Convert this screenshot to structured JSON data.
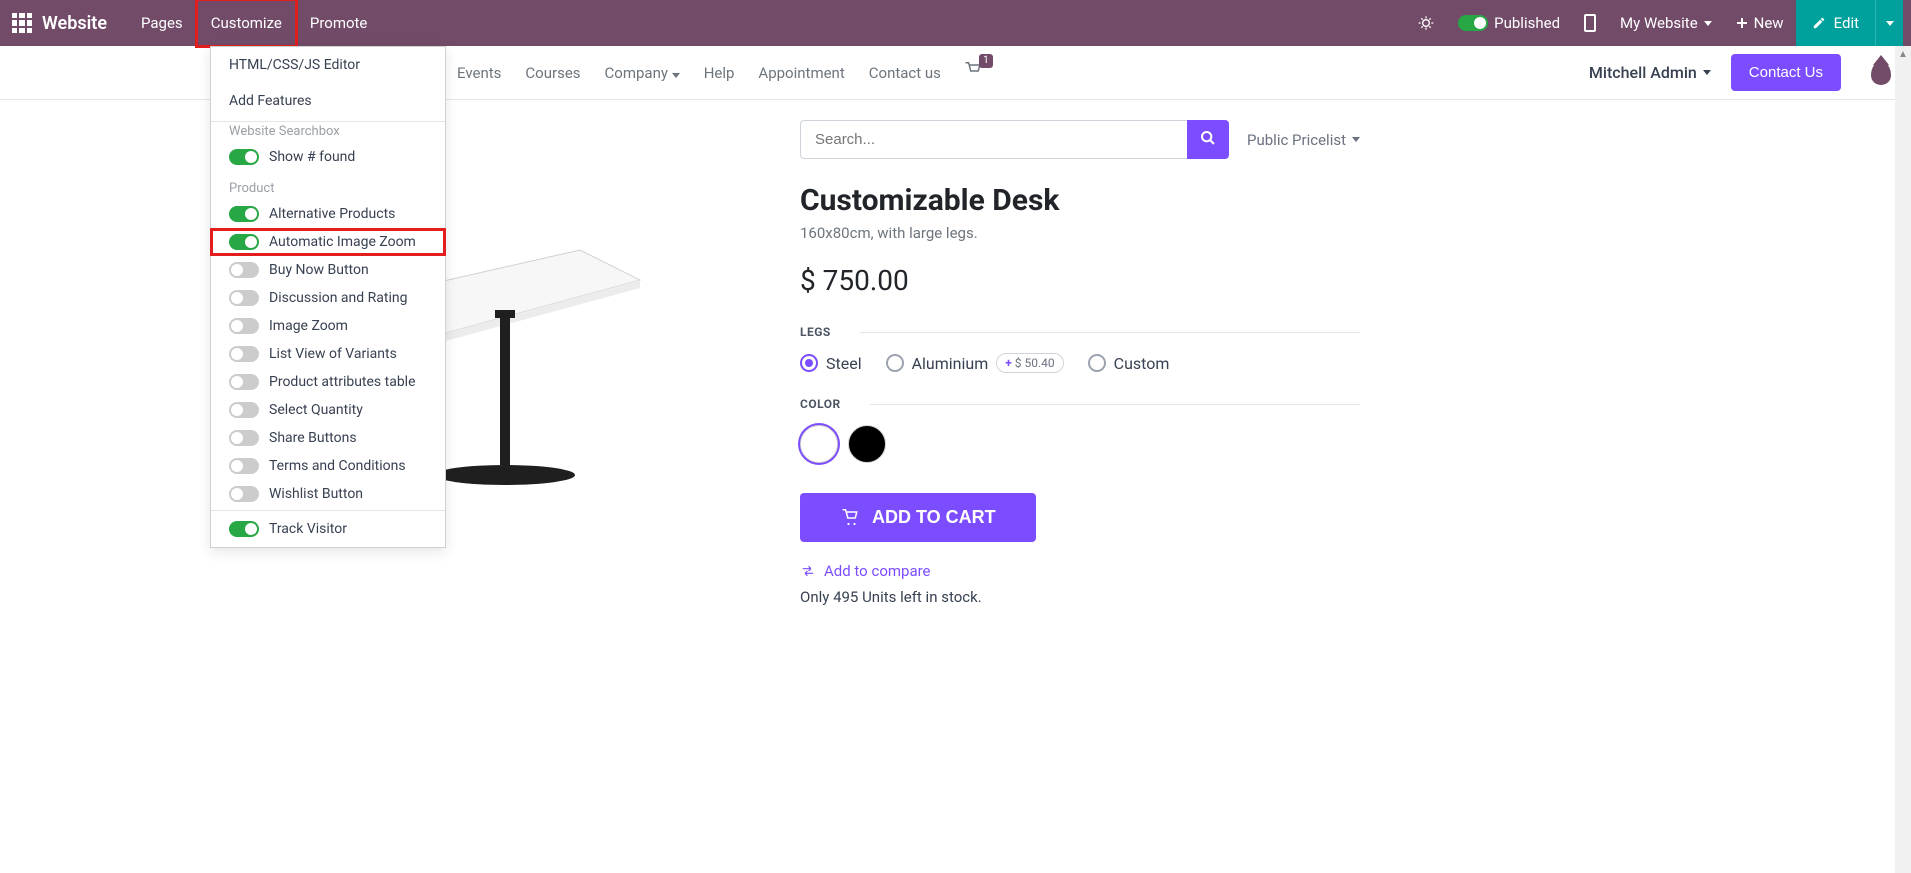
{
  "topbar": {
    "brand": "Website",
    "menu": {
      "pages": "Pages",
      "customize": "Customize",
      "promote": "Promote"
    },
    "published": "Published",
    "my_website": "My Website",
    "new": "New",
    "edit": "Edit"
  },
  "dropdown": {
    "html_editor": "HTML/CSS/JS Editor",
    "add_features": "Add Features",
    "section_searchbox": "Website Searchbox",
    "show_found": "Show # found",
    "section_product": "Product",
    "alternative_products": "Alternative Products",
    "auto_image_zoom": "Automatic Image Zoom",
    "buy_now": "Buy Now Button",
    "discussion_rating": "Discussion and Rating",
    "image_zoom": "Image Zoom",
    "list_view_variants": "List View of Variants",
    "product_attr_table": "Product attributes table",
    "select_quantity": "Select Quantity",
    "share_buttons": "Share Buttons",
    "terms_conditions": "Terms and Conditions",
    "wishlist_button": "Wishlist Button",
    "track_visitor": "Track Visitor"
  },
  "nav": {
    "events": "Events",
    "courses": "Courses",
    "company": "Company",
    "help": "Help",
    "appointment": "Appointment",
    "contact_us": "Contact us",
    "cart_count": "1",
    "user": "Mitchell Admin",
    "contact_btn": "Contact Us"
  },
  "search": {
    "placeholder": "Search...",
    "pricelist": "Public Pricelist"
  },
  "product": {
    "title": "Customizable Desk",
    "subtitle": "160x80cm, with large legs.",
    "price": "$ 750.00",
    "legs_label": "LEGS",
    "legs": {
      "steel": "Steel",
      "aluminium": "Aluminium",
      "alu_extra": "$ 50.40",
      "custom": "Custom"
    },
    "color_label": "COLOR",
    "add_to_cart": "ADD TO CART",
    "compare": "Add to compare",
    "stock": "Only 495 Units left in stock."
  }
}
